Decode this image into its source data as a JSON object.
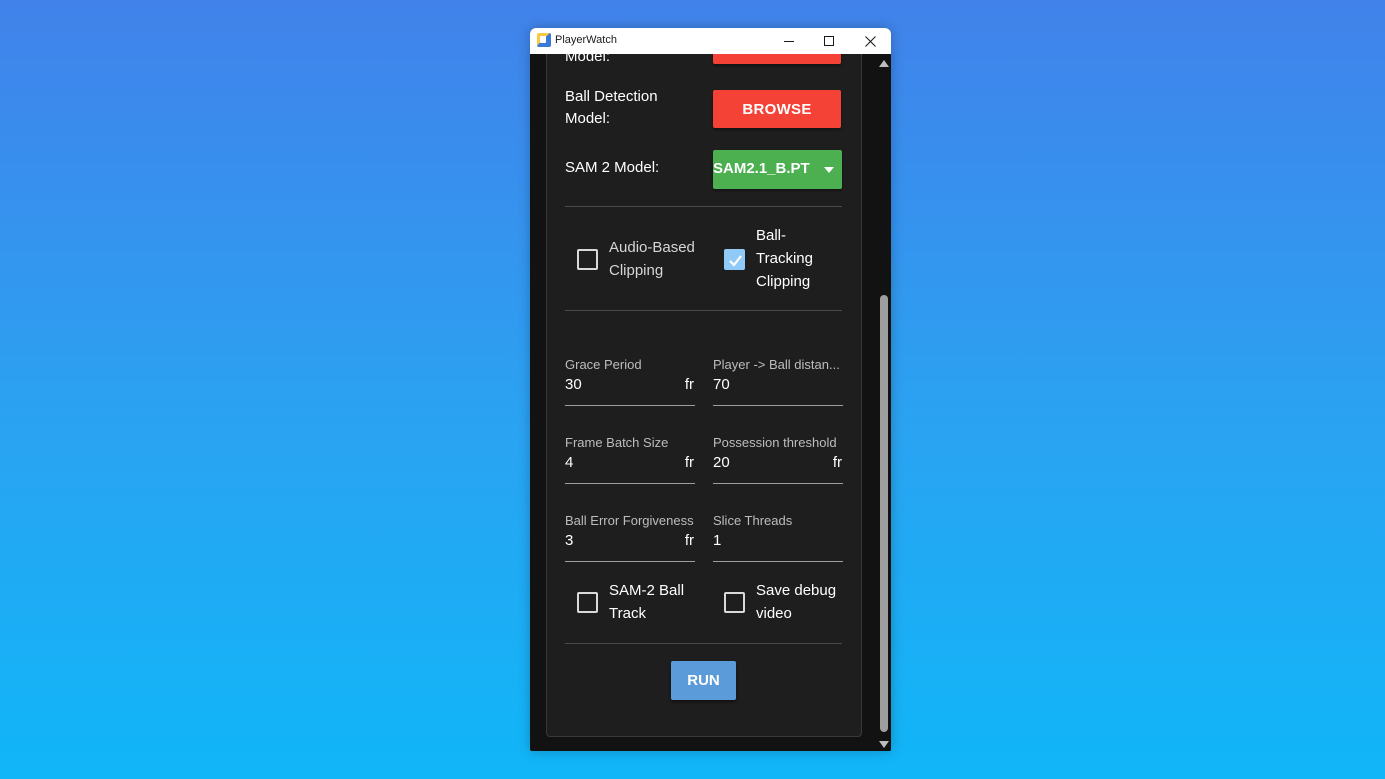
{
  "window": {
    "title": "PlayerWatch"
  },
  "controls": {
    "minimize": "minimize",
    "maximize": "maximize",
    "close": "close"
  },
  "models": {
    "player_model_label_tail": "Model:",
    "ball_detection_label": "Ball Detection Model:",
    "ball_detection_button": "BROWSE",
    "sam2_label": "SAM 2 Model:",
    "sam2_value": "SAM2.1_B.PT"
  },
  "clipping": {
    "audio": {
      "label": "Audio-Based Clipping",
      "checked": false
    },
    "ball_tracking": {
      "label": "Ball-Tracking Clipping",
      "checked": true
    }
  },
  "fields": {
    "grace_period": {
      "label": "Grace Period",
      "value": "30",
      "unit": "fr"
    },
    "player_ball_distance": {
      "label": "Player -> Ball distan...",
      "value": "70",
      "unit": ""
    },
    "frame_batch_size": {
      "label": "Frame Batch Size",
      "value": "4",
      "unit": "fr"
    },
    "possession_threshold": {
      "label": "Possession threshold",
      "value": "20",
      "unit": "fr"
    },
    "ball_error_forgiveness": {
      "label": "Ball Error Forgiveness",
      "value": "3",
      "unit": "fr"
    },
    "slice_threads": {
      "label": "Slice Threads",
      "value": "1",
      "unit": ""
    }
  },
  "options": {
    "sam2_ball_track": {
      "label": "SAM-2 Ball Track",
      "checked": false
    },
    "save_debug_video": {
      "label": "Save debug video",
      "checked": false
    }
  },
  "actions": {
    "run": "RUN"
  },
  "colors": {
    "browse": "#f44336",
    "dropdown": "#4caf50",
    "run": "#5c9bd9",
    "checkbox_checked": "#90caf9"
  }
}
